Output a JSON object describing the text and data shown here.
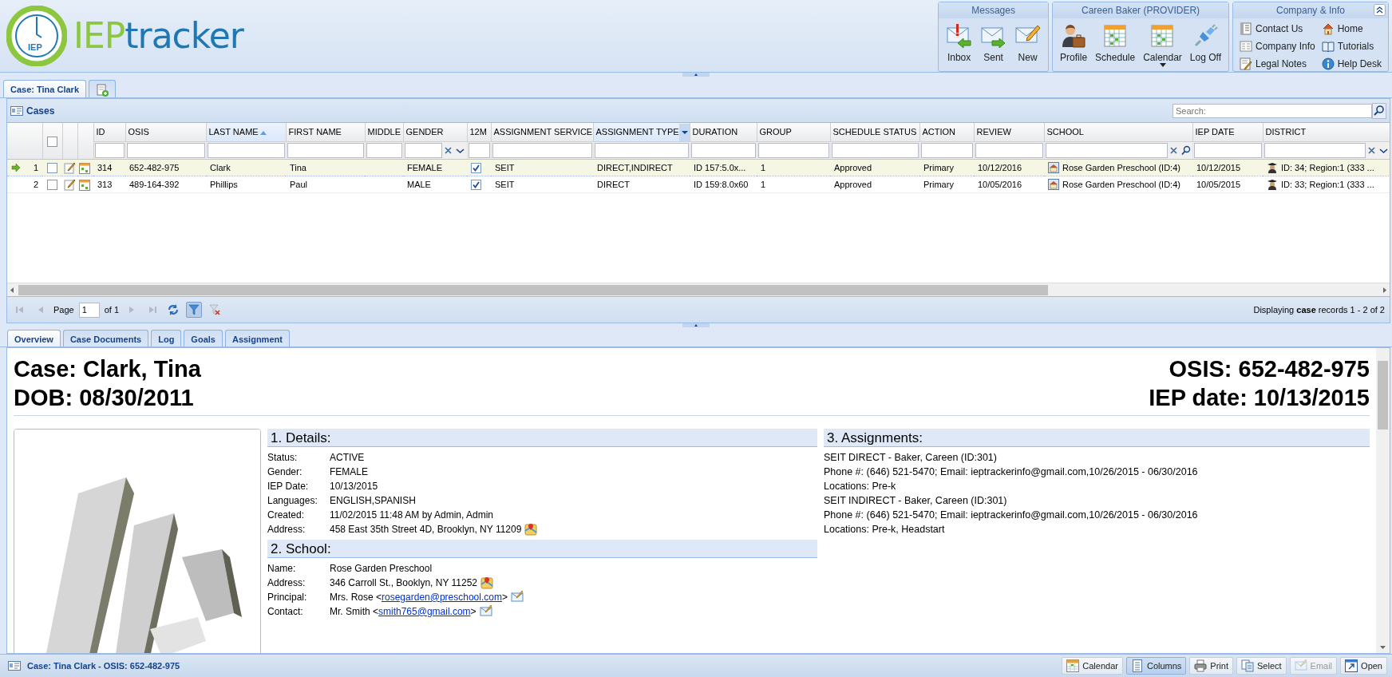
{
  "logo": {
    "badge": "IEP",
    "first": "IEP",
    "second": "tracker"
  },
  "toolbar_groups": [
    {
      "title": "Messages",
      "buttons": [
        {
          "label": "Inbox",
          "dropdown": false
        },
        {
          "label": "Sent",
          "dropdown": false
        },
        {
          "label": "New",
          "dropdown": false
        }
      ]
    },
    {
      "title": "Careen Baker (PROVIDER)",
      "buttons": [
        {
          "label": "Profile",
          "dropdown": false
        },
        {
          "label": "Schedule",
          "dropdown": false
        },
        {
          "label": "Calendar",
          "dropdown": true
        },
        {
          "label": "Log Off",
          "dropdown": false
        }
      ]
    }
  ],
  "info_group": {
    "title": "Company & Info",
    "links": [
      "Contact Us",
      "Home",
      "Company Info",
      "Tutorials",
      "Legal Notes",
      "Help Desk"
    ]
  },
  "tabs": [
    {
      "label": "Case: Tina Clark",
      "selected": true
    }
  ],
  "cases": {
    "title": "Cases",
    "search": {
      "placeholder": "Search:"
    },
    "all_checked": false,
    "columns": [
      {
        "label": "ID",
        "kind": "text",
        "sorted": false,
        "menu_open": false
      },
      {
        "label": "OSIS",
        "kind": "text",
        "sorted": false,
        "menu_open": false
      },
      {
        "label": "LAST NAME",
        "kind": "text",
        "sorted": true,
        "menu_open": false
      },
      {
        "label": "FIRST NAME",
        "kind": "text",
        "sorted": false,
        "menu_open": false
      },
      {
        "label": "MIDDLE",
        "kind": "text",
        "sorted": false,
        "menu_open": false
      },
      {
        "label": "GENDER",
        "kind": "text",
        "sorted": false,
        "menu_open": false
      },
      {
        "label": "12M",
        "kind": "check",
        "sorted": false,
        "menu_open": false
      },
      {
        "label": "ASSIGNMENT SERVICE",
        "kind": "text",
        "sorted": false,
        "menu_open": false
      },
      {
        "label": "ASSIGNMENT TYPE",
        "kind": "text",
        "sorted": false,
        "menu_open": true
      },
      {
        "label": "DURATION",
        "kind": "text",
        "sorted": false,
        "menu_open": false
      },
      {
        "label": "GROUP",
        "kind": "text",
        "sorted": false,
        "menu_open": false
      },
      {
        "label": "SCHEDULE STATUS",
        "kind": "text",
        "sorted": false,
        "menu_open": false
      },
      {
        "label": "ACTION",
        "kind": "text",
        "sorted": false,
        "menu_open": false
      },
      {
        "label": "REVIEW",
        "kind": "text",
        "sorted": false,
        "menu_open": false
      },
      {
        "label": "SCHOOL",
        "kind": "school",
        "sorted": false,
        "menu_open": false
      },
      {
        "label": "IEP DATE",
        "kind": "text",
        "sorted": false,
        "menu_open": false
      },
      {
        "label": "DISTRICT",
        "kind": "district",
        "sorted": false,
        "menu_open": false
      }
    ],
    "rows": [
      {
        "number": "1",
        "selected": true,
        "checked": false,
        "cells": [
          "314",
          "652-482-975",
          "Clark",
          "Tina",
          null,
          "FEMALE",
          true,
          "SEIT",
          "DIRECT,INDIRECT",
          "ID 157:5.0x...",
          "1",
          "Approved",
          "Primary",
          "10/12/2016",
          "Rose Garden Preschool (ID:4)",
          "10/12/2015",
          "ID: 34; Region:1 (333 ..."
        ]
      },
      {
        "number": "2",
        "selected": false,
        "checked": false,
        "cells": [
          "313",
          "489-164-392",
          "Phillips",
          "Paul",
          null,
          "MALE",
          true,
          "SEIT",
          "DIRECT",
          "ID 159:8.0x60",
          "1",
          "Approved",
          "Primary",
          "10/05/2016",
          "Rose Garden Preschool (ID:4)",
          "10/05/2015",
          "ID: 33; Region:1 (333 ..."
        ]
      }
    ]
  },
  "pager": {
    "page_label": "Page",
    "page": "1",
    "of": "of 1",
    "filter_on": true,
    "summary": "Displaying **case** records 1 - 2 of 2"
  },
  "detail_tabs": [
    {
      "label": "Overview",
      "selected": true
    },
    {
      "label": "Case Documents",
      "selected": false
    },
    {
      "label": "Log",
      "selected": false
    },
    {
      "label": "Goals",
      "selected": false
    },
    {
      "label": "Assignment",
      "selected": false
    }
  ],
  "case_header": {
    "name": "Case: Clark, Tina",
    "dob": "DOB: 08/30/2011",
    "osis": "OSIS: 652-482-975",
    "iep_date": "IEP date: 10/13/2015"
  },
  "sections": [
    {
      "title": "1. Details:",
      "fields": [
        {
          "label": "Status:",
          "value": "ACTIVE",
          "kind": "text"
        },
        {
          "label": "Gender:",
          "value": "FEMALE",
          "kind": "text"
        },
        {
          "label": "IEP Date:",
          "value": "10/13/2015",
          "kind": "text"
        },
        {
          "label": "Languages:",
          "value": "ENGLISH,SPANISH",
          "kind": "text"
        },
        {
          "label": "Created:",
          "value": "11/02/2015 11:48 AM by Admin, Admin",
          "kind": "text"
        },
        {
          "label": "Address:",
          "value": "458 East 35th Street 4D, Brooklyn, NY 11209",
          "kind": "map"
        }
      ]
    },
    {
      "title": "2. School:",
      "fields": [
        {
          "label": "Name:",
          "value": "Rose Garden Preschool",
          "kind": "text"
        },
        {
          "label": "Address:",
          "value": "346 Carroll St., Booklyn, NY 11252",
          "kind": "map"
        },
        {
          "label": "Principal:",
          "value": "Mrs. Rose <",
          "link": "rosegarden@preschool.com",
          "after": ">",
          "kind": "email"
        },
        {
          "label": "Contact:",
          "value": "Mr. Smith <",
          "link": "smith765@gmail.com",
          "after": ">",
          "kind": "email"
        }
      ]
    }
  ],
  "assignments": {
    "title": "3. Assignments:",
    "entries": [
      {
        "title": "SEIT DIRECT - Baker, Careen (ID:301)",
        "contact": "Phone #: (646) 521-5470; Email: ieptrackerinfo@gmail.com,10/26/2015 - 06/30/2016",
        "locations": "Locations: Pre-k"
      },
      {
        "title": "SEIT INDIRECT - Baker, Careen (ID:301)",
        "contact": "Phone #: (646) 521-5470; Email: ieptrackerinfo@gmail.com,10/26/2015 - 06/30/2016",
        "locations": "Locations: Pre-k, Headstart"
      }
    ]
  },
  "status_bar": {
    "text": "Case: Tina Clark - OSIS: 652-482-975",
    "buttons": [
      {
        "label": "Calendar",
        "pressed": false,
        "disabled": false
      },
      {
        "label": "Columns",
        "pressed": true,
        "disabled": false
      },
      {
        "label": "Print",
        "pressed": false,
        "disabled": false
      },
      {
        "label": "Select",
        "pressed": false,
        "disabled": false
      },
      {
        "label": "Email",
        "pressed": false,
        "disabled": true
      },
      {
        "label": "Open",
        "pressed": false,
        "disabled": false
      }
    ]
  }
}
